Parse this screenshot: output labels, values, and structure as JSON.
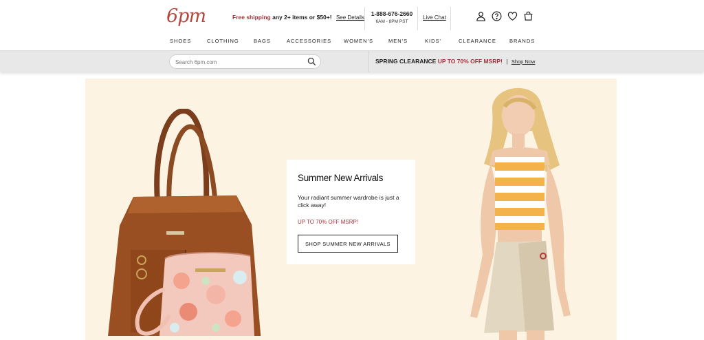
{
  "header": {
    "logo": "6pm",
    "promo": {
      "highlight": "Free shipping",
      "text": "any 2+ items or $50+!",
      "link": "See Details"
    },
    "phone": {
      "number": "1-888-676-2660",
      "hours": "6AM - 8PM PST"
    },
    "chat": "Live Chat",
    "icons": [
      "account-icon",
      "help-icon",
      "heart-icon",
      "cart-icon"
    ]
  },
  "nav": {
    "items": [
      "SHOES",
      "CLOTHING",
      "BAGS",
      "ACCESSORIES",
      "WOMEN'S",
      "MEN'S",
      "KIDS'",
      "CLEARANCE",
      "BRANDS"
    ]
  },
  "search": {
    "placeholder": "Search 6pm.com"
  },
  "clearance_banner": {
    "label": "SPRING CLEARANCE",
    "highlight": "UP TO 70% OFF MSRP!",
    "separator": "|",
    "link": "Shop Now"
  },
  "hero": {
    "title": "Summer New Arrivals",
    "description": "Your radiant summer wardrobe is just a click away!",
    "sale": "UP TO 70% OFF MSRP!",
    "button": "SHOP SUMMER NEW ARRIVALS"
  },
  "colors": {
    "brand": "#b5483e",
    "accent": "#a8313d",
    "hero_bg": "#fdf3e3"
  }
}
